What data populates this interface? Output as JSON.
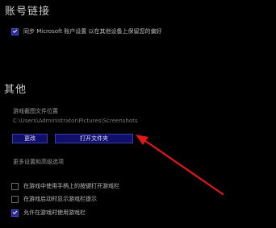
{
  "account_section": {
    "title": "账号链接",
    "sync_checkbox": {
      "label": "同步 Microsoft 账户设置 以在其他设备上保留您的偏好",
      "checked": true
    }
  },
  "other_section": {
    "title": "其他",
    "location_label": "游戏截图文件位置",
    "location_path": "C:\\Users\\Administrator\\Pictures\\Screenshots",
    "change_button": "更改",
    "open_folder_button": "打开文件夹",
    "advanced_label": "更多设置和高级选项",
    "options": [
      {
        "label": "在游戏中使用手柄上的按键打开游戏栏",
        "checked": false
      },
      {
        "label": "在游戏启动时显示游戏栏提示",
        "checked": false
      },
      {
        "label": "允许在游戏时使用游戏栏",
        "checked": true
      }
    ]
  },
  "colors": {
    "background": "#000000",
    "button_bg": "#10106a",
    "checkbox_checked": "#2a2a8e",
    "annotation_arrow": "#e01818"
  }
}
